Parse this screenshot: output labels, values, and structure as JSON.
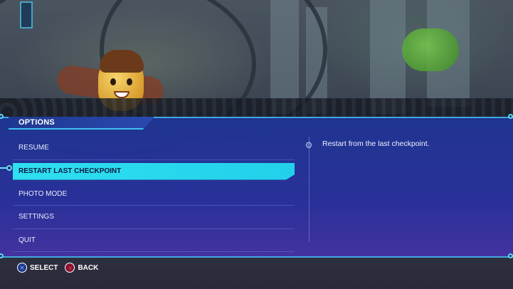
{
  "menu": {
    "title": "OPTIONS",
    "items": [
      {
        "label": "RESUME",
        "selected": false
      },
      {
        "label": "RESTART LAST CHECKPOINT",
        "selected": true
      },
      {
        "label": "PHOTO MODE",
        "selected": false
      },
      {
        "label": "SETTINGS",
        "selected": false
      },
      {
        "label": "QUIT",
        "selected": false
      }
    ]
  },
  "description": {
    "icon": "gear-icon",
    "text": "Restart from the last checkpoint."
  },
  "footer": {
    "select": {
      "icon": "cross-button-icon",
      "label": "SELECT"
    },
    "back": {
      "icon": "circle-button-icon",
      "label": "BACK"
    }
  },
  "colors": {
    "accent": "#2fe0f0",
    "panel": "#2a3ca0",
    "border": "#3fa8e0"
  }
}
